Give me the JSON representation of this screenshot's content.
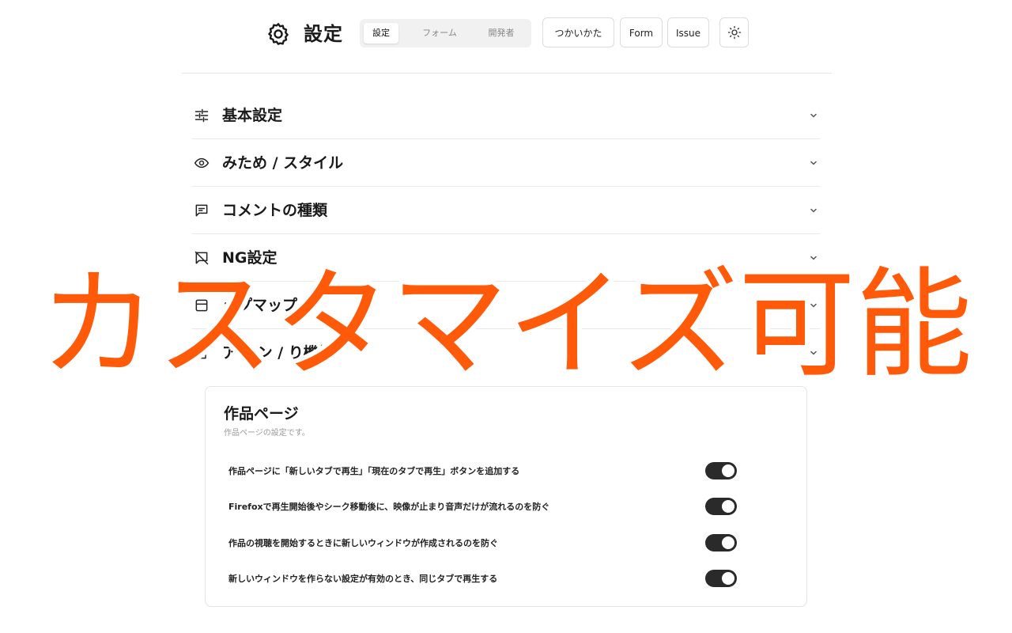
{
  "header": {
    "title": "設定",
    "tabs": [
      {
        "label": "設定",
        "active": true
      },
      {
        "label": "フォーム",
        "active": false
      },
      {
        "label": "開発者",
        "active": false
      }
    ],
    "buttons": {
      "guide": "つかいかた",
      "form": "Form",
      "issue": "Issue"
    },
    "theme_icon": "sun-icon",
    "settings_icon": "gear-icon"
  },
  "sections": [
    {
      "label": "基本設定",
      "icon": "sliders-icon"
    },
    {
      "label": "みため / スタイル",
      "icon": "eye-icon"
    },
    {
      "label": "コメントの種類",
      "icon": "comment-icon"
    },
    {
      "label": "NG設定",
      "icon": "ng-icon"
    },
    {
      "label": "ップマップ",
      "icon": "layout-icon"
    },
    {
      "label": "ア オン / り機能",
      "icon": "addon-icon"
    }
  ],
  "card": {
    "title": "作品ページ",
    "description": "作品ページの設定です。",
    "options": [
      {
        "label": "作品ページに「新しいタブで再生」「現在のタブで再生」ボタンを追加する",
        "enabled": true
      },
      {
        "label": "Firefoxで再生開始後やシーク移動後に、映像が止まり音声だけが流れるのを防ぐ",
        "enabled": true
      },
      {
        "label": "作品の視聴を開始するときに新しいウィンドウが作成されるのを防ぐ",
        "enabled": true
      },
      {
        "label": "新しいウィンドウを作らない設定が有効のとき、同じタブで再生する",
        "enabled": true
      }
    ]
  },
  "overlay": {
    "text": "カスタマイズ可能",
    "color": "#ff5a0a"
  },
  "colors": {
    "toggle_on": "#2a2a2a",
    "accent_overlay": "#ff5a0a"
  }
}
